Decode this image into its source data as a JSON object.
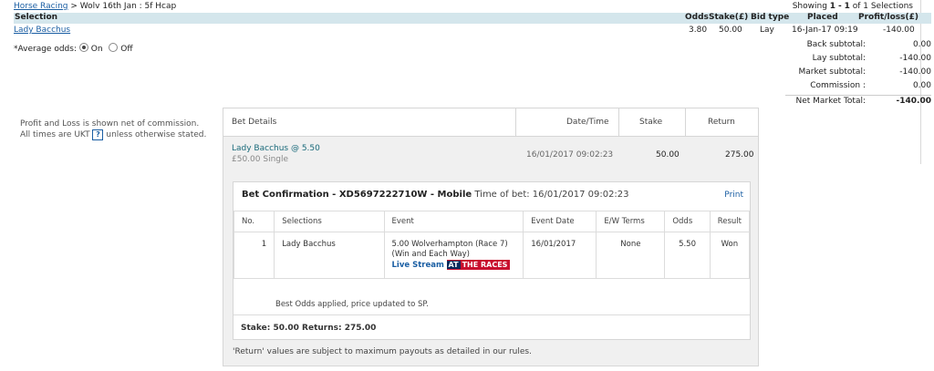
{
  "breadcrumb": {
    "link": "Horse Racing",
    "separator": ">",
    "market": "Wolv 16th Jan : 5f Hcap"
  },
  "showing": {
    "prefix": "Showing",
    "from": "1",
    "dash": "-",
    "to": "1",
    "of_text": "of 1 Selections"
  },
  "columns": {
    "selection": "Selection",
    "odds": "Odds",
    "stake": "Stake(£)",
    "bid_type": "Bid type",
    "placed": "Placed",
    "profit_loss": "Profit/loss(£)"
  },
  "row": {
    "selection": "Lady Bacchus",
    "odds": "3.80",
    "stake": "50.00",
    "bid_type": "Lay",
    "placed": "16-Jan-17 09:19",
    "profit_loss": "-140.00"
  },
  "avg_odds": {
    "label": "*Average odds:",
    "on": "On",
    "off": "Off"
  },
  "subtotals": [
    {
      "label": "Back subtotal:",
      "value": "0.00"
    },
    {
      "label": "Lay subtotal:",
      "value": "-140.00"
    },
    {
      "label": "Market subtotal:",
      "value": "-140.00"
    },
    {
      "label": "Commission :",
      "value": "0.00"
    }
  ],
  "net_total": {
    "label": "Net Market Total:",
    "value": "-140.00"
  },
  "notes": {
    "line1": "Profit and Loss is shown net of commission.",
    "line2_pre": "All times are UKT",
    "help": "?",
    "line2_post": "unless otherwise stated."
  },
  "bet_panel": {
    "headers": {
      "details": "Bet Details",
      "datetime": "Date/Time",
      "stake": "Stake",
      "return": "Return"
    },
    "selection": {
      "name": "Lady Bacchus @ 5.50",
      "sub": "£50.00  Single",
      "datetime": "16/01/2017 09:02:23",
      "stake": "50.00",
      "return": "275.00"
    },
    "confirmation": {
      "title": "Bet Confirmation - XD5697222710W - Mobile",
      "time_label": "Time of bet: 16/01/2017 09:02:23",
      "print": "Print",
      "table_headers": {
        "no": "No.",
        "selections": "Selections",
        "event": "Event",
        "event_date": "Event Date",
        "ew_terms": "E/W Terms",
        "odds": "Odds",
        "result": "Result"
      },
      "line": {
        "no": "1",
        "selection": "Lady Bacchus",
        "event_line1": "5.00 Wolverhampton (Race 7)",
        "event_line2": "(Win and Each Way)",
        "live_stream": "Live Stream",
        "atr_at": "AT",
        "atr_rest": "THE RACES",
        "event_date": "16/01/2017",
        "ew_terms": "None",
        "odds": "5.50",
        "result": "Won"
      },
      "best_odds": "Best Odds applied, price updated to SP.",
      "footer": "Stake: 50.00  Returns: 275.00"
    },
    "disclaimer": "'Return' values are subject to maximum payouts as detailed in our rules."
  }
}
